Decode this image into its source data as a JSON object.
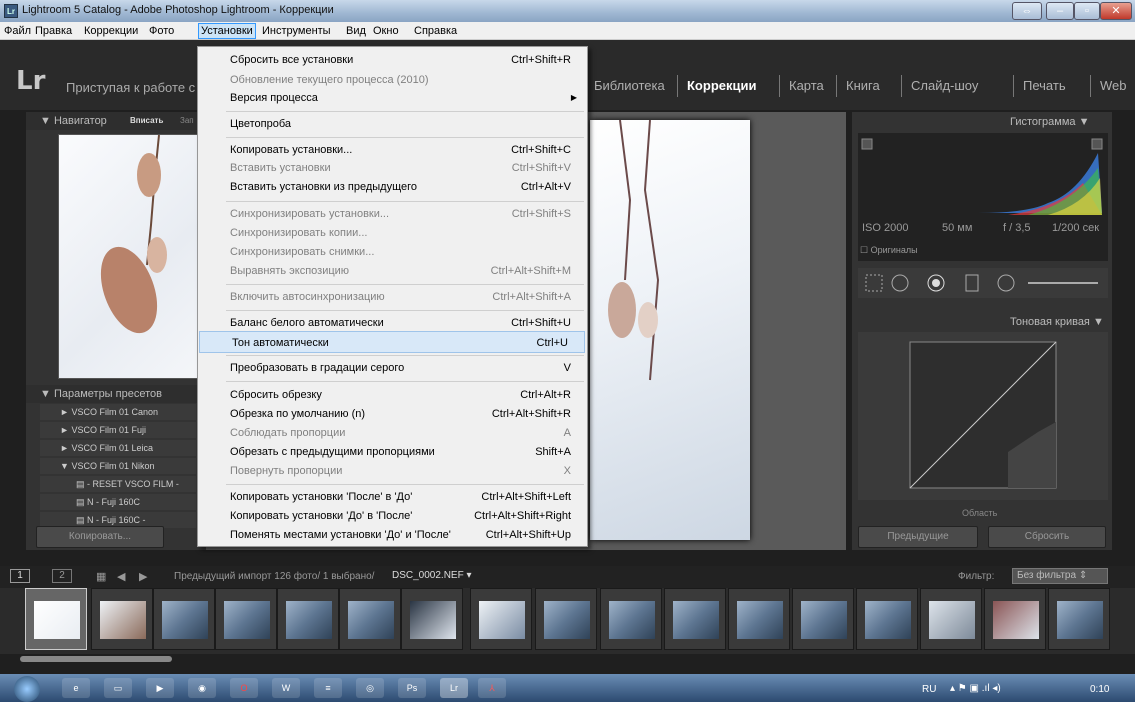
{
  "window": {
    "title": "Lightroom 5 Catalog - Adobe Photoshop Lightroom - Коррекции",
    "icon": "Lr"
  },
  "menubar": {
    "items": [
      "Файл",
      "Правка",
      "Коррекции",
      "Фото",
      "Установки",
      "Инструменты",
      "Вид",
      "Окно",
      "Справка"
    ]
  },
  "header": {
    "logo": "Lr",
    "intro": "Приступая к работе с L",
    "modules": [
      "Библиотека",
      "Коррекции",
      "Карта",
      "Книга",
      "Слайд-шоу",
      "Печать",
      "Web"
    ],
    "active_module": "Коррекции"
  },
  "left_panel": {
    "navigator_title": "Навигатор",
    "navigator_fit": "Вписать",
    "navigator_fill": "Зап",
    "presets_title": "Параметры пресетов",
    "presets": [
      {
        "label": "VSCO Film 01 Canon",
        "arrow": "►"
      },
      {
        "label": "VSCO Film 01 Fuji",
        "arrow": "►"
      },
      {
        "label": "VSCO Film 01 Leica",
        "arrow": "►"
      },
      {
        "label": "VSCO Film 01 Nikon",
        "arrow": "▼"
      },
      {
        "label": "- RESET VSCO FILM -",
        "arrow": "▤"
      },
      {
        "label": "N - Fuji 160C",
        "arrow": "▤"
      },
      {
        "label": "N - Fuji 160C -",
        "arrow": "▤"
      }
    ],
    "copy_button": "Копировать..."
  },
  "right_panel": {
    "histogram_title": "Гистограмма",
    "iso": "ISO 2000",
    "focal": "50 мм",
    "aperture": "f / 3,5",
    "shutter": "1/200 сек",
    "originals": "Оригиналы",
    "tone_curve_title": "Тоновая кривая",
    "region": "Область",
    "previous_button": "Предыдущие",
    "reset_button": "Сбросить"
  },
  "filmstrip": {
    "page1": "1",
    "page2": "2",
    "info": "Предыдущий импорт  126 фото/ 1 выбрано/",
    "filename": "DSC_0002.NEF",
    "filter_label": "Фильтр:",
    "filter_value": "Без фильтра"
  },
  "menu": {
    "items": [
      {
        "label": "Сбросить все установки",
        "shortcut": "Ctrl+Shift+R",
        "enabled": true
      },
      {
        "label": "Обновление текущего процесса (2010)",
        "shortcut": "",
        "enabled": false
      },
      {
        "label": "Версия процесса",
        "shortcut": "",
        "enabled": true,
        "submenu": true
      },
      {
        "label": "Цветопроба",
        "shortcut": "",
        "enabled": true
      },
      {
        "label": "Копировать установки...",
        "shortcut": "Ctrl+Shift+C",
        "enabled": true
      },
      {
        "label": "Вставить установки",
        "shortcut": "Ctrl+Shift+V",
        "enabled": false
      },
      {
        "label": "Вставить установки из предыдущего",
        "shortcut": "Ctrl+Alt+V",
        "enabled": true
      },
      {
        "label": "Синхронизировать установки...",
        "shortcut": "Ctrl+Shift+S",
        "enabled": false
      },
      {
        "label": "Синхронизировать копии...",
        "shortcut": "",
        "enabled": false
      },
      {
        "label": "Синхронизировать снимки...",
        "shortcut": "",
        "enabled": false
      },
      {
        "label": "Выравнять экспозицию",
        "shortcut": "Ctrl+Alt+Shift+M",
        "enabled": false
      },
      {
        "label": "Включить автосинхронизацию",
        "shortcut": "Ctrl+Alt+Shift+A",
        "enabled": false
      },
      {
        "label": "Баланс белого автоматически",
        "shortcut": "Ctrl+Shift+U",
        "enabled": true
      },
      {
        "label": "Тон автоматически",
        "shortcut": "Ctrl+U",
        "enabled": true,
        "highlighted": true
      },
      {
        "label": "Преобразовать в градации серого",
        "shortcut": "V",
        "enabled": true
      },
      {
        "label": "Сбросить обрезку",
        "shortcut": "Ctrl+Alt+R",
        "enabled": true
      },
      {
        "label": "Обрезка по умолчанию (n)",
        "shortcut": "Ctrl+Alt+Shift+R",
        "enabled": true
      },
      {
        "label": "Соблюдать пропорции",
        "shortcut": "A",
        "enabled": false
      },
      {
        "label": "Обрезать с предыдущими пропорциями",
        "shortcut": "Shift+A",
        "enabled": true
      },
      {
        "label": "Повернуть пропорции",
        "shortcut": "X",
        "enabled": false
      },
      {
        "label": "Копировать установки 'После' в 'До'",
        "shortcut": "Ctrl+Alt+Shift+Left",
        "enabled": true
      },
      {
        "label": "Копировать установки 'До' в 'После'",
        "shortcut": "Ctrl+Alt+Shift+Right",
        "enabled": true
      },
      {
        "label": "Поменять местами установки 'До' и 'После'",
        "shortcut": "Ctrl+Alt+Shift+Up",
        "enabled": true
      }
    ]
  },
  "taskbar": {
    "lang": "RU",
    "time": "0:10",
    "apps": [
      "start",
      "ie",
      "explorer",
      "media",
      "chrome",
      "opera",
      "word",
      "notepad",
      "camera",
      "photoshop",
      "lightroom",
      "acrobat"
    ]
  },
  "colors": {
    "highlight": "#d8e8f8",
    "menu_bg": "#f0f0f0",
    "panel": "#333333"
  }
}
